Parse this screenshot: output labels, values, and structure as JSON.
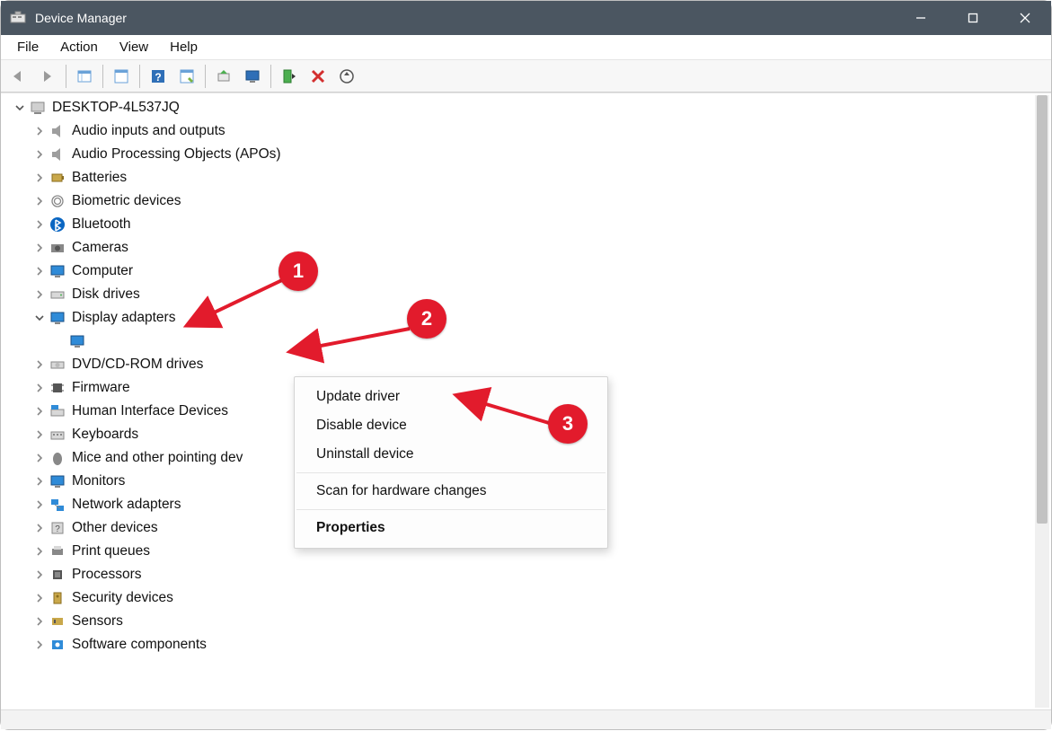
{
  "window": {
    "title": "Device Manager"
  },
  "menu": {
    "file": "File",
    "action": "Action",
    "view": "View",
    "help": "Help"
  },
  "toolbar_icons": {
    "back": "back-icon",
    "forward": "forward-icon",
    "showhide": "showhide-icon",
    "details": "details-icon",
    "help": "help-icon",
    "propsheet": "propsheet-icon",
    "update": "update-icon",
    "dispwiz": "dispwiz-icon",
    "enable": "enable-icon",
    "uninstall": "uninstall-icon",
    "scan": "scan-icon"
  },
  "tree": {
    "root": "DESKTOP-4L537JQ",
    "items": [
      {
        "label": "Audio inputs and outputs",
        "icon": "speaker-icon"
      },
      {
        "label": "Audio Processing Objects (APOs)",
        "icon": "speaker-icon"
      },
      {
        "label": "Batteries",
        "icon": "battery-icon"
      },
      {
        "label": "Biometric devices",
        "icon": "fingerprint-icon"
      },
      {
        "label": "Bluetooth",
        "icon": "bluetooth-icon"
      },
      {
        "label": "Cameras",
        "icon": "camera-icon"
      },
      {
        "label": "Computer",
        "icon": "monitor-icon"
      },
      {
        "label": "Disk drives",
        "icon": "disk-icon"
      },
      {
        "label": "Display adapters",
        "icon": "gpu-icon",
        "expanded": true,
        "children": [
          {
            "label": "",
            "icon": "gpu-icon"
          }
        ]
      },
      {
        "label": "DVD/CD-ROM drives",
        "icon": "optical-icon"
      },
      {
        "label": "Firmware",
        "icon": "chip-icon"
      },
      {
        "label": "Human Interface Devices",
        "icon": "hid-icon"
      },
      {
        "label": "Keyboards",
        "icon": "keyboard-icon"
      },
      {
        "label": "Mice and other pointing dev",
        "icon": "mouse-icon"
      },
      {
        "label": "Monitors",
        "icon": "monitor-icon"
      },
      {
        "label": "Network adapters",
        "icon": "network-icon"
      },
      {
        "label": "Other devices",
        "icon": "unknown-icon"
      },
      {
        "label": "Print queues",
        "icon": "printer-icon"
      },
      {
        "label": "Processors",
        "icon": "cpu-icon"
      },
      {
        "label": "Security devices",
        "icon": "security-icon"
      },
      {
        "label": "Sensors",
        "icon": "sensor-icon"
      },
      {
        "label": "Software components",
        "icon": "software-icon"
      }
    ]
  },
  "ctx": {
    "update": "Update driver",
    "disable": "Disable device",
    "uninstall": "Uninstall device",
    "scan": "Scan for hardware changes",
    "props": "Properties"
  },
  "annotations": {
    "step1": "1",
    "step2": "2",
    "step3": "3"
  }
}
